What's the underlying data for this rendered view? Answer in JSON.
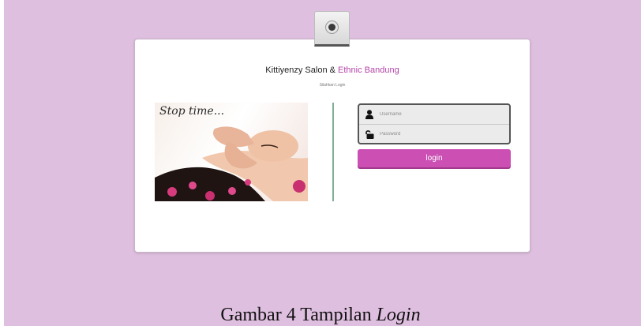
{
  "header": {
    "title_prefix": "Kittiyenzy Salon & ",
    "title_accent": "Ethnic Bandung",
    "subtitle": "Silahkan Login"
  },
  "image": {
    "caption": "Stop time..."
  },
  "form": {
    "username_placeholder": "Username",
    "password_placeholder": "Password",
    "login_label": "login"
  },
  "figure_caption": {
    "prefix": "Gambar 4 Tampilan ",
    "emphasis": "Login"
  },
  "icons": {
    "camera": "webcam-icon",
    "username": "user-icon",
    "password": "unlock-icon"
  },
  "colors": {
    "background": "#dfbfdf",
    "accent": "#b445a8",
    "button": "#cc4fb4",
    "divider": "#7fae95"
  }
}
